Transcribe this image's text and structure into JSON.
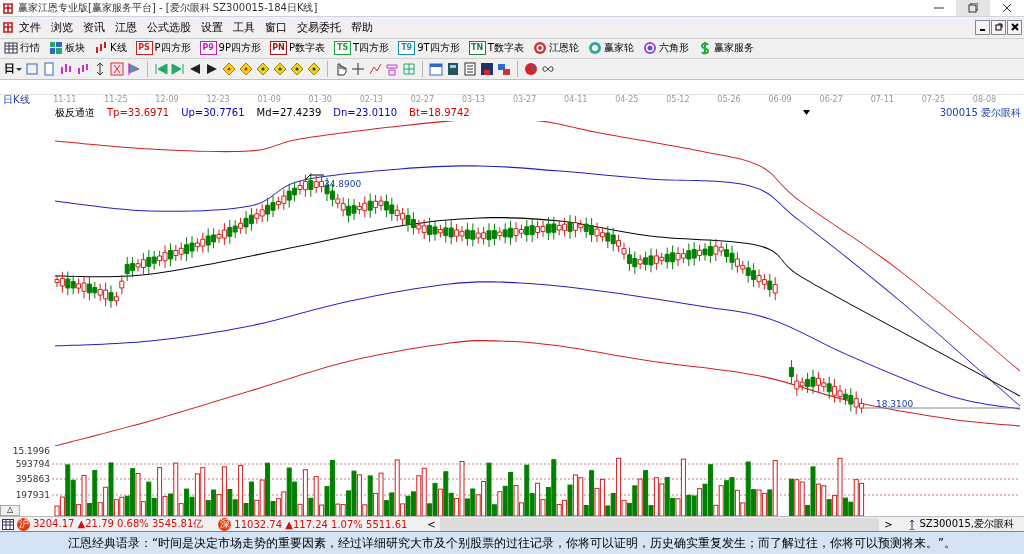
{
  "window": {
    "title": "赢家江恩专业版[赢家服务平台] - [爱尔眼科  SZ300015-184日K线]"
  },
  "menu": [
    "文件",
    "浏览",
    "资讯",
    "江恩",
    "公式选股",
    "设置",
    "工具",
    "窗口",
    "交易委托",
    "帮助"
  ],
  "toolbar": [
    {
      "kind": "icon",
      "label": "行情"
    },
    {
      "kind": "icon",
      "label": "板块"
    },
    {
      "kind": "icon",
      "label": "K线"
    },
    {
      "kind": "badge",
      "badge": "PS",
      "color": "#d02020",
      "label": "P四方形"
    },
    {
      "kind": "badge",
      "badge": "P9",
      "color": "#c020c0",
      "label": "9P四方形"
    },
    {
      "kind": "badge",
      "badge": "PN",
      "color": "#a01818",
      "label": "P数字表"
    },
    {
      "kind": "badge",
      "badge": "TS",
      "color": "#20a030",
      "label": "T四方形"
    },
    {
      "kind": "badge",
      "badge": "T9",
      "color": "#1890b0",
      "label": "9T四方形"
    },
    {
      "kind": "badge",
      "badge": "TN",
      "color": "#208040",
      "label": "T数字表"
    },
    {
      "kind": "icon",
      "label": "江恩轮"
    },
    {
      "kind": "icon",
      "label": "赢家轮"
    },
    {
      "kind": "icon",
      "label": "六角形"
    },
    {
      "kind": "icon",
      "label": "赢家服务"
    }
  ],
  "period_button": "日",
  "chart": {
    "period": "日K线",
    "dates": [
      "11-11",
      "11-25",
      "12-09",
      "12-23",
      "01-09",
      "01-30",
      "02-13",
      "02-27",
      "03-13",
      "03-27",
      "04-11",
      "04-25",
      "05-12",
      "05-26",
      "06-09",
      "06-27",
      "07-11",
      "07-25",
      "08-08"
    ],
    "indicator": "极反通道",
    "readings": [
      {
        "text": "Tp=33.6971",
        "kind": "top"
      },
      {
        "text": "Up=30.7761",
        "kind": "upper"
      },
      {
        "text": "Md=27.4239",
        "kind": "middle"
      },
      {
        "text": "Dn=23.0110",
        "kind": "lower"
      },
      {
        "text": "Bt=18.9742",
        "kind": "bottom"
      }
    ],
    "stock": "300015  爱尔眼科",
    "high_label": "34.8900",
    "low_label": "18.3100",
    "volume_labels": [
      "15.1996",
      "593794",
      "395863",
      "197931"
    ],
    "collapse_button": "△"
  },
  "status": {
    "indices": [
      {
        "badge": "沪",
        "text": "3204.17 ▲21.79 0.68% 3545.81亿"
      },
      {
        "badge": "深",
        "text": "11032.74 ▲117.24 1.07% 5511.61"
      }
    ],
    "scroll_left": "<",
    "scroll_right": ">",
    "stock": "SZ300015,爱尔眼科"
  },
  "quote": "江恩经典语录：“时间是决定市场走势的重要因素，经过详细研究大市及个别股票的过往记录，你将可以证明，历史确实重复发生；而了解过往，你将可以预测将来。”。"
}
